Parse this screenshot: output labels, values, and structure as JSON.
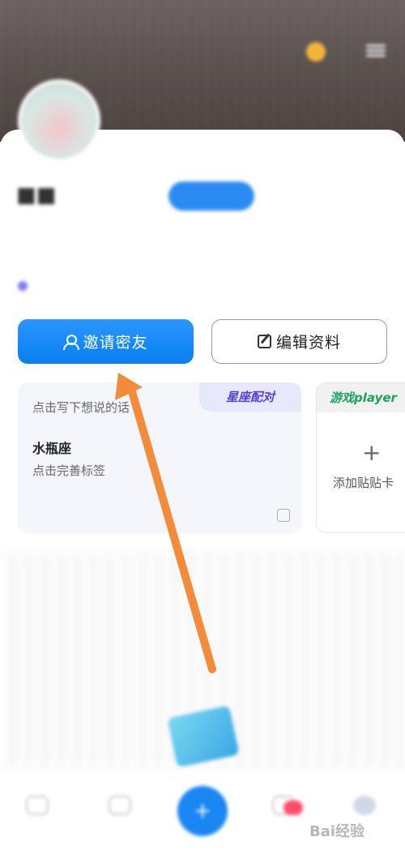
{
  "status_bar": {
    "time": "",
    "right": ""
  },
  "header": {
    "coin_icon": "coin-icon",
    "menu_icon": "menu-icon"
  },
  "profile": {
    "username": "",
    "user_tag": "",
    "badge": "",
    "user_id": "",
    "bio": "",
    "tags": ""
  },
  "actions": {
    "invite_label": "邀请密友",
    "invite_icon": "person-icon",
    "edit_label": "编辑资料",
    "edit_icon": "edit-icon"
  },
  "cards": {
    "zodiac": {
      "header": "星座配对",
      "prompt": "点击写下想说的话",
      "name": "水瓶座",
      "sub": "点击完善标签"
    },
    "game": {
      "header": "游戏player",
      "plus": "+",
      "add_label": "添加贴贴卡"
    }
  },
  "tab_bar": {
    "fab": "+",
    "tabs": [
      "",
      "",
      "",
      ""
    ]
  },
  "watermark": "Bai经验",
  "colors": {
    "accent": "#1a86f2",
    "annotation_arrow": "#f28c3a"
  }
}
